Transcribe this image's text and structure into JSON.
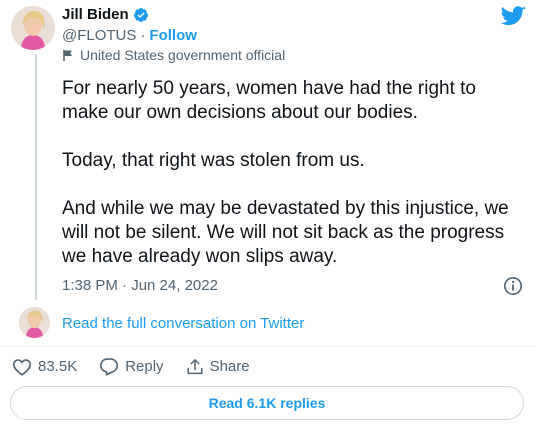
{
  "author": {
    "name": "Jill Biden",
    "handle": "@FLOTUS",
    "separator": "·",
    "follow_label": "Follow",
    "label": "United States government official"
  },
  "tweet": {
    "paragraphs": [
      "For nearly 50 years, women have had the right to make our own decisions about our bodies.",
      "Today, that right was stolen from us.",
      "And while we may be devastated by this injustice, we will not be silent. We will not sit back as the progress we have already won slips away."
    ],
    "timestamp": "1:38 PM · Jun 24, 2022"
  },
  "conversation": {
    "link_label": "Read the full conversation on Twitter"
  },
  "actions": {
    "likes": "83.5K",
    "reply_label": "Reply",
    "share_label": "Share"
  },
  "read_replies_label": "Read 6.1K replies",
  "colors": {
    "accent": "#1d9bf0",
    "muted": "#536471",
    "text": "#0f1419"
  }
}
